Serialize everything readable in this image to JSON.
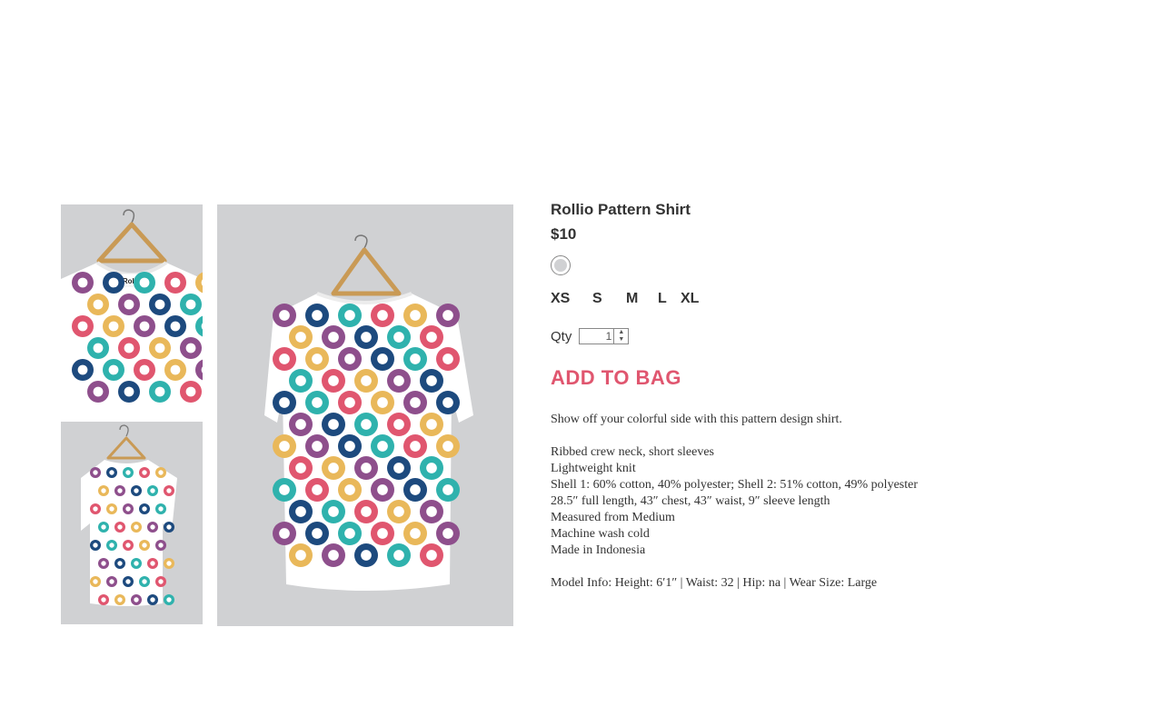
{
  "product": {
    "title": "Rollio Pattern Shirt",
    "price": "$10",
    "swatch_color": "#d0d1d3",
    "sizes": [
      "XS",
      "S",
      "M",
      "L",
      "XL"
    ],
    "qty_label": "Qty",
    "qty_value": "1",
    "add_to_bag": "ADD TO BAG",
    "tagline": "Show off your colorful side with this pattern design shirt.",
    "details": [
      "Ribbed crew neck, short sleeves",
      "Lightweight knit",
      "Shell 1: 60% cotton, 40% polyester; Shell 2: 51% cotton, 49% polyester",
      "28.5″ full length, 43″ chest, 43″ waist, 9″ sleeve length",
      "Measured from Medium",
      "Machine wash cold",
      "Made in Indonesia"
    ],
    "model_info": "Model Info: Height: 6′1″ | Waist: 32 | Hip: na | Wear Size: Large"
  },
  "images": {
    "label_text": "Rollio",
    "background": "#d0d1d3",
    "dot_colors": [
      "#8e4f8c",
      "#e0566f",
      "#1d4a7e",
      "#e9b85a",
      "#2fb2ad"
    ]
  }
}
